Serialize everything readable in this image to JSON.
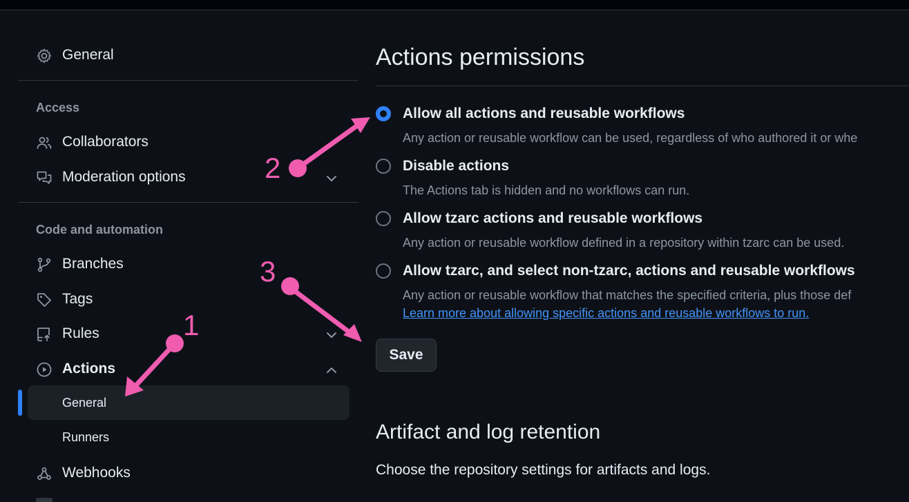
{
  "sidebar": {
    "general": "General",
    "access_heading": "Access",
    "collaborators": "Collaborators",
    "moderation": "Moderation options",
    "code_heading": "Code and automation",
    "branches": "Branches",
    "tags": "Tags",
    "rules": "Rules",
    "actions": "Actions",
    "actions_sub": [
      "General",
      "Runners"
    ],
    "webhooks": "Webhooks"
  },
  "main": {
    "title": "Actions permissions",
    "options": [
      {
        "title": "Allow all actions and reusable workflows",
        "desc": "Any action or reusable workflow can be used, regardless of who authored it or whe",
        "checked": true
      },
      {
        "title": "Disable actions",
        "desc": "The Actions tab is hidden and no workflows can run.",
        "checked": false
      },
      {
        "title": "Allow tzarc actions and reusable workflows",
        "desc": "Any action or reusable workflow defined in a repository within tzarc can be used.",
        "checked": false
      },
      {
        "title": "Allow tzarc, and select non-tzarc, actions and reusable workflows",
        "desc": "Any action or reusable workflow that matches the specified criteria, plus those def",
        "link": "Learn more about allowing specific actions and reusable workflows to run.",
        "checked": false
      }
    ],
    "save_label": "Save",
    "artifact_title": "Artifact and log retention",
    "artifact_desc": "Choose the repository settings for artifacts and logs."
  },
  "annotations": [
    "1",
    "2",
    "3"
  ],
  "colors": {
    "accent": "#2f81f7",
    "annotation": "#f05cb0",
    "bg": "#0d1117",
    "link": "#4493f8"
  }
}
